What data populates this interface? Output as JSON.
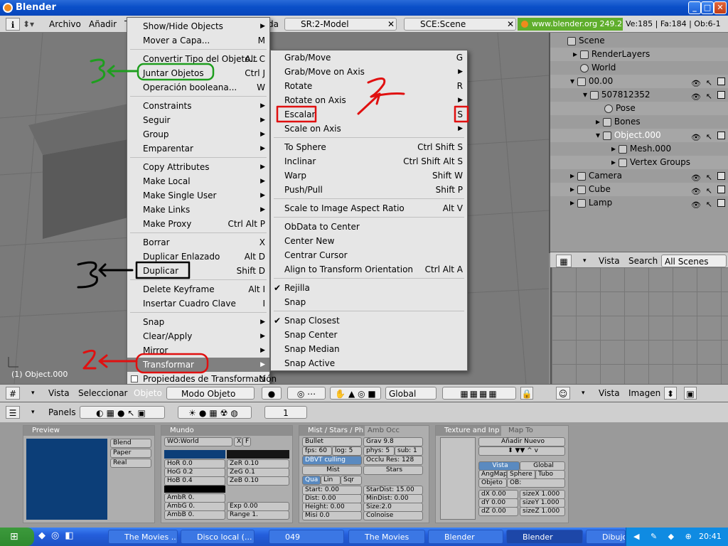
{
  "window": {
    "title": "Blender"
  },
  "top_header": {
    "menus": [
      "Archivo",
      "Añadir",
      "T"
    ],
    "screen_field": "SR:2-Model",
    "scene_field": "SCE:Scene",
    "partial_label": "da",
    "url": "www.blender.org 249.2",
    "stats": "Ve:185 | Fa:184 | Ob:6-1"
  },
  "viewport": {
    "object_label": "(1) Object.000"
  },
  "outliner": {
    "rows": [
      "Scene",
      "RenderLayers",
      "World",
      "00.00",
      "507812352",
      "Pose",
      "Bones",
      "Object.000",
      "Mesh.000",
      "Vertex Groups",
      "Camera",
      "Cube",
      "Lamp"
    ],
    "header": {
      "view": "Vista",
      "search": "Search",
      "scenes": "All Scenes"
    }
  },
  "view_header": {
    "view": "Vista",
    "select": "Seleccionar",
    "object": "Objeto",
    "mode": "Modo Objeto",
    "orientation": "Global",
    "right_view": "Vista",
    "right_image": "Imagen"
  },
  "buttons_header": {
    "panels": "Panels",
    "frame": "1"
  },
  "panels": {
    "preview": {
      "title": "Preview",
      "buttons": [
        "Blend",
        "Paper",
        "Real"
      ]
    },
    "world": {
      "title": "Mundo",
      "field": "WO:World",
      "f": "F",
      "x": "X",
      "rows": [
        "HoR 0.0",
        "HoG 0.2",
        "HoB 0.4",
        "ZeR 0.10",
        "ZeG 0.1",
        "ZeB 0.10",
        "AmbR 0.",
        "AmbG 0.",
        "AmbB 0.",
        "Exp 0.00",
        "Range 1."
      ]
    },
    "mist": {
      "title": "Mist / Stars / Ph",
      "tab2": "Amb Occ",
      "rows": [
        "Bullet",
        "Grav 9.8",
        "fps: 60",
        "log: 5",
        "phys: 5",
        "sub: 1",
        "DBVT culling",
        "Occlu Res: 128",
        "Mist",
        "Stars",
        "Qua",
        "Lin",
        "Sqr",
        "Start: 0.00",
        "StarDist: 15.00",
        "Dist: 0.00",
        "MinDist: 0.00",
        "Height: 0.00",
        "Size:2.0",
        "Misi 0.0",
        "Colnoise"
      ]
    },
    "texture": {
      "title": "Texture and Inp",
      "tab2": "Map To",
      "add_new": "Añadir Nuevo",
      "rows": [
        "Vista",
        "Global",
        "AngMap",
        "Sphere",
        "Tubo",
        "Objeto",
        "OB:",
        "dX 0.00",
        "sizeX 1.000",
        "dY 0.00",
        "sizeY 1.000",
        "dZ 0.00",
        "sizeZ 1.000"
      ]
    }
  },
  "object_menu": {
    "items": [
      {
        "label": "Show/Hide Objects",
        "shortcut": "",
        "sub": true
      },
      {
        "label": "Mover a Capa...",
        "shortcut": "M",
        "sub": false
      },
      {
        "label": "Convertir Tipo del Objeto...",
        "shortcut": "Alt C",
        "sub": false
      },
      {
        "label": "Juntar Objetos",
        "shortcut": "Ctrl J",
        "sub": false
      },
      {
        "label": "Operación booleana...",
        "shortcut": "W",
        "sub": false
      },
      {
        "label": "Constraints",
        "shortcut": "",
        "sub": true
      },
      {
        "label": "Seguir",
        "shortcut": "",
        "sub": true
      },
      {
        "label": "Group",
        "shortcut": "",
        "sub": true
      },
      {
        "label": "Emparentar",
        "shortcut": "",
        "sub": true
      },
      {
        "label": "Copy Attributes",
        "shortcut": "",
        "sub": true
      },
      {
        "label": "Make Local",
        "shortcut": "",
        "sub": true
      },
      {
        "label": "Make Single User",
        "shortcut": "",
        "sub": true
      },
      {
        "label": "Make Links",
        "shortcut": "",
        "sub": true
      },
      {
        "label": "Make Proxy",
        "shortcut": "Ctrl Alt P",
        "sub": false
      },
      {
        "label": "Borrar",
        "shortcut": "X",
        "sub": false
      },
      {
        "label": "Duplicar Enlazado",
        "shortcut": "Alt D",
        "sub": false
      },
      {
        "label": "Duplicar",
        "shortcut": "Shift D",
        "sub": false
      },
      {
        "label": "Delete Keyframe",
        "shortcut": "Alt I",
        "sub": false
      },
      {
        "label": "Insertar Cuadro Clave",
        "shortcut": "I",
        "sub": false
      },
      {
        "label": "Snap",
        "shortcut": "",
        "sub": true
      },
      {
        "label": "Clear/Apply",
        "shortcut": "",
        "sub": true
      },
      {
        "label": "Mirror",
        "shortcut": "",
        "sub": true
      },
      {
        "label": "Transformar",
        "shortcut": "",
        "sub": true
      },
      {
        "label": "Propiedades de Transformación",
        "shortcut": "N",
        "sub": false
      }
    ]
  },
  "transform_menu": {
    "items": [
      {
        "label": "Grab/Move",
        "shortcut": "G",
        "sub": false
      },
      {
        "label": "Grab/Move on Axis",
        "shortcut": "",
        "sub": true
      },
      {
        "label": "Rotate",
        "shortcut": "R",
        "sub": false
      },
      {
        "label": "Rotate on Axis",
        "shortcut": "",
        "sub": true
      },
      {
        "label": "Escalar",
        "shortcut": "S",
        "sub": false
      },
      {
        "label": "Scale on Axis",
        "shortcut": "",
        "sub": true
      },
      {
        "label": "To Sphere",
        "shortcut": "Ctrl Shift S",
        "sub": false
      },
      {
        "label": "Inclinar",
        "shortcut": "Ctrl Shift Alt S",
        "sub": false
      },
      {
        "label": "Warp",
        "shortcut": "Shift W",
        "sub": false
      },
      {
        "label": "Push/Pull",
        "shortcut": "Shift P",
        "sub": false
      },
      {
        "label": "Scale to Image Aspect Ratio",
        "shortcut": "Alt V",
        "sub": false
      },
      {
        "label": "ObData to Center",
        "shortcut": "",
        "sub": false
      },
      {
        "label": "Center New",
        "shortcut": "",
        "sub": false
      },
      {
        "label": "Centrar Cursor",
        "shortcut": "",
        "sub": false
      },
      {
        "label": "Align to Transform Orientation",
        "shortcut": "Ctrl Alt A",
        "sub": false
      },
      {
        "label": "Rejilla",
        "shortcut": "",
        "sub": false
      },
      {
        "label": "Snap",
        "shortcut": "",
        "sub": false
      },
      {
        "label": "Snap Closest",
        "shortcut": "",
        "sub": false
      },
      {
        "label": "Snap Center",
        "shortcut": "",
        "sub": false
      },
      {
        "label": "Snap Median",
        "shortcut": "",
        "sub": false
      },
      {
        "label": "Snap Active",
        "shortcut": "",
        "sub": false
      }
    ]
  },
  "taskbar": {
    "tasks": [
      "The Movies ...",
      "Disco local (...",
      "049",
      "The Movies",
      "Blender",
      "Blender",
      "Dibujo - Paint"
    ],
    "clock": "20:41"
  },
  "colors": {
    "annotation_green": "#1e9e1e",
    "annotation_red": "#e01010",
    "annotation_black": "#000000"
  }
}
